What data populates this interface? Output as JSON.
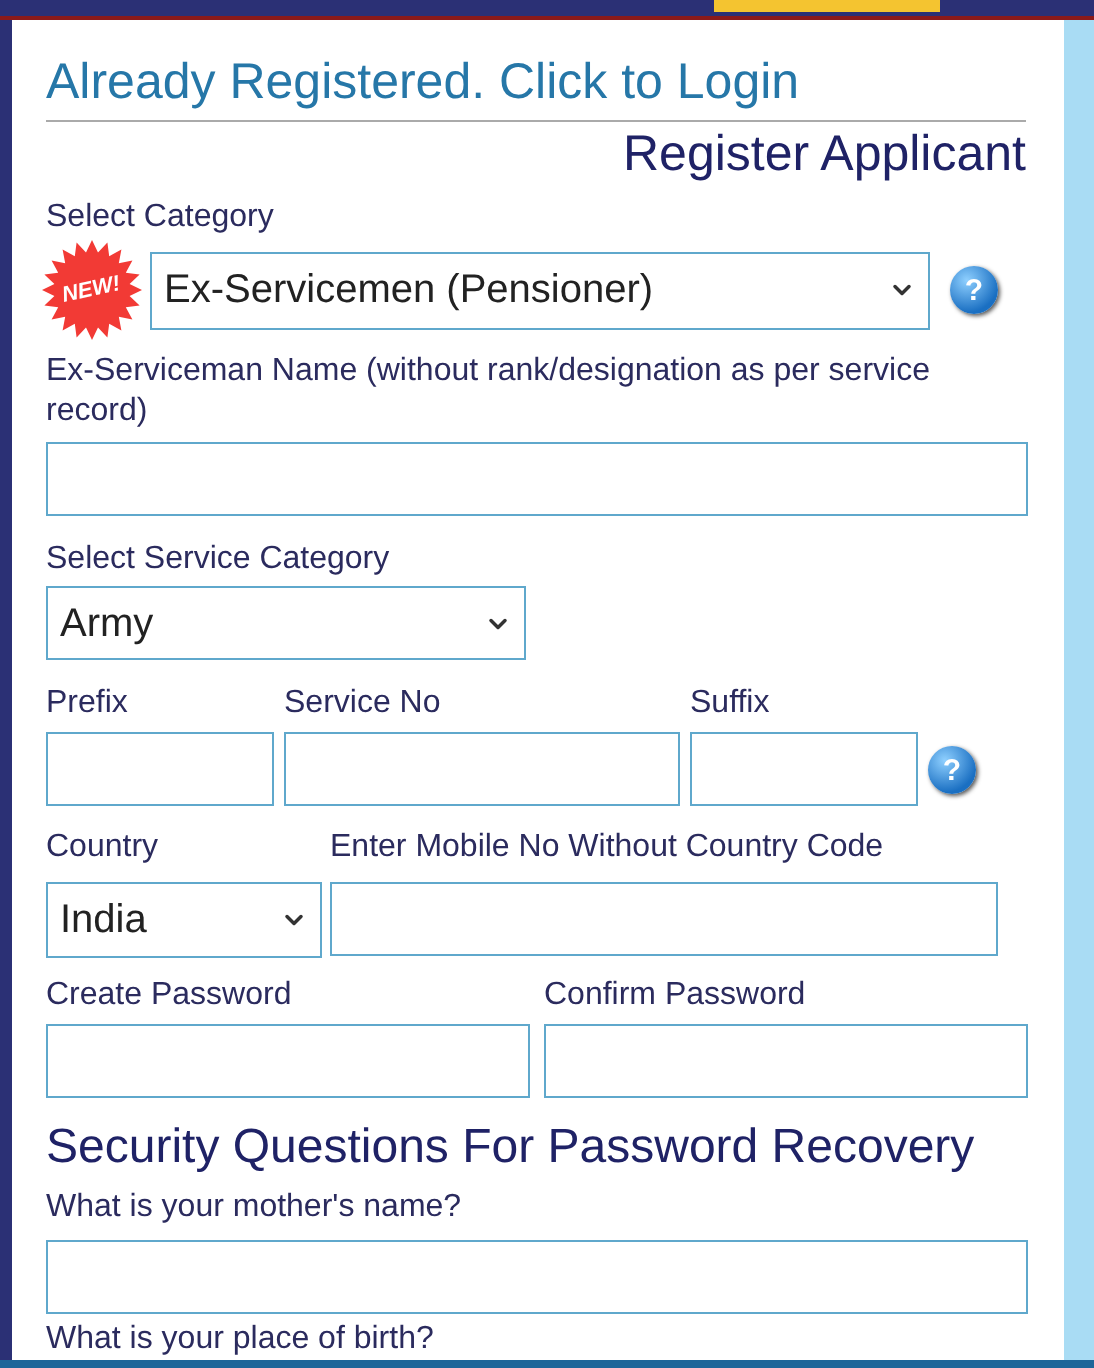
{
  "login_link": "Already Registered. Click to Login",
  "heading": "Register Applicant",
  "category": {
    "label": "Select Category",
    "badge": "NEW!",
    "value": "Ex-Servicemen (Pensioner)",
    "help": "?"
  },
  "name_field": {
    "label": "Ex-Serviceman Name (without rank/designation as per service record)"
  },
  "service_category": {
    "label": "Select Service Category",
    "value": "Army"
  },
  "service_no_row": {
    "fields": [
      {
        "label": "Prefix"
      },
      {
        "label": "Service No"
      },
      {
        "label": "Suffix"
      }
    ],
    "help": "?"
  },
  "contact_row": [
    {
      "label": "Country",
      "kind": "select",
      "value": "India"
    },
    {
      "label": "Enter Mobile No Without Country Code",
      "kind": "text"
    }
  ],
  "password_row": [
    {
      "label": "Create Password"
    },
    {
      "label": "Confirm Password"
    }
  ],
  "security": {
    "heading": "Security Questions For Password Recovery",
    "questions": [
      {
        "label": "What is your mother's name?"
      }
    ],
    "next_question": "What is your place of birth?"
  }
}
